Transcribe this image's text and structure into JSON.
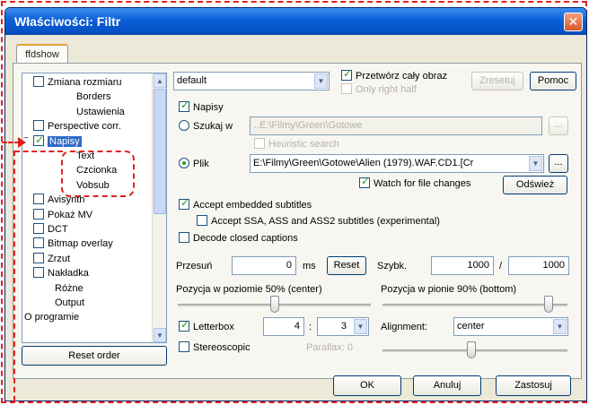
{
  "window": {
    "title": "Właściwości: Filtr",
    "close_glyph": "✕"
  },
  "tab": {
    "label": "ffdshow"
  },
  "tree": {
    "items": [
      {
        "label": "Zmiana rozmiaru",
        "checkbox": true,
        "checked": false
      },
      {
        "label": "Borders",
        "checkbox": false
      },
      {
        "label": "Ustawienia",
        "checkbox": false
      },
      {
        "label": "Perspective corr.",
        "checkbox": true,
        "checked": false
      },
      {
        "label": "Napisy",
        "checkbox": true,
        "checked": true,
        "selected": true
      },
      {
        "label": "Text",
        "checkbox": false
      },
      {
        "label": "Czcionka",
        "checkbox": false
      },
      {
        "label": "Vobsub",
        "checkbox": false
      },
      {
        "label": "Avisynth",
        "checkbox": true,
        "checked": false
      },
      {
        "label": "Pokaż MV",
        "checkbox": true,
        "checked": false
      },
      {
        "label": "DCT",
        "checkbox": true,
        "checked": false
      },
      {
        "label": "Bitmap overlay",
        "checkbox": true,
        "checked": false
      },
      {
        "label": "Zrzut",
        "checkbox": true,
        "checked": false
      },
      {
        "label": "Nakładka",
        "checkbox": true,
        "checked": false
      },
      {
        "label": "Różne",
        "checkbox": false
      },
      {
        "label": "Output",
        "checkbox": false
      },
      {
        "label": "O programie",
        "checkbox": false
      }
    ],
    "reset_order_label": "Reset order"
  },
  "top": {
    "preset_value": "default",
    "process_whole_label": "Przetwórz cały obraz",
    "only_right_half_label": "Only right half",
    "zresetuj_label": "Zresetuj",
    "pomoc_label": "Pomoc"
  },
  "subs": {
    "napisy_label": "Napisy",
    "szukaj_label": "Szukaj w",
    "szukaj_value": "..E:\\Filmy\\Green\\Gotowe",
    "heuristic_label": "Heuristic search",
    "plik_label": "Plik",
    "plik_value": "E:\\Filmy\\Green\\Gotowe\\Alien (1979).WAF.CD1.[Cr",
    "browse_label": "...",
    "watch_label": "Watch for file changes",
    "odswiez_label": "Odśwież",
    "accept_embedded_label": "Accept embedded subtitles",
    "accept_ssa_label": "Accept SSA, ASS and ASS2 subtitles (experimental)",
    "decode_cc_label": "Decode closed captions",
    "przesun_label": "Przesuń",
    "przesun_value": "0",
    "ms_label": "ms",
    "reset_label": "Reset",
    "szybk_label": "Szybk.",
    "szybk_value1": "1000",
    "slash": "/",
    "szybk_value2": "1000",
    "poz_poziom_label": "Pozycja w poziomie",
    "poz_poziom_value": "50% (center)",
    "poz_pion_label": "Pozycja w pionie",
    "poz_pion_value": "90% (bottom)",
    "poz_poziom_fraction": 0.5,
    "poz_pion_fraction": 0.9,
    "letterbox_label": "Letterbox",
    "letterbox_a": "4",
    "colon": ":",
    "letterbox_b": "3",
    "alignment_label": "Alignment:",
    "alignment_value": "center",
    "stereoscopic_label": "Stereoscopic",
    "parallax_label": "Parallax: 0"
  },
  "footer": {
    "ok_label": "OK",
    "cancel_label": "Anuluj",
    "apply_label": "Zastosuj"
  },
  "colors": {
    "accent": "#316ac5",
    "annotation": "#e02020",
    "titlebar": "#0a5fd6"
  }
}
